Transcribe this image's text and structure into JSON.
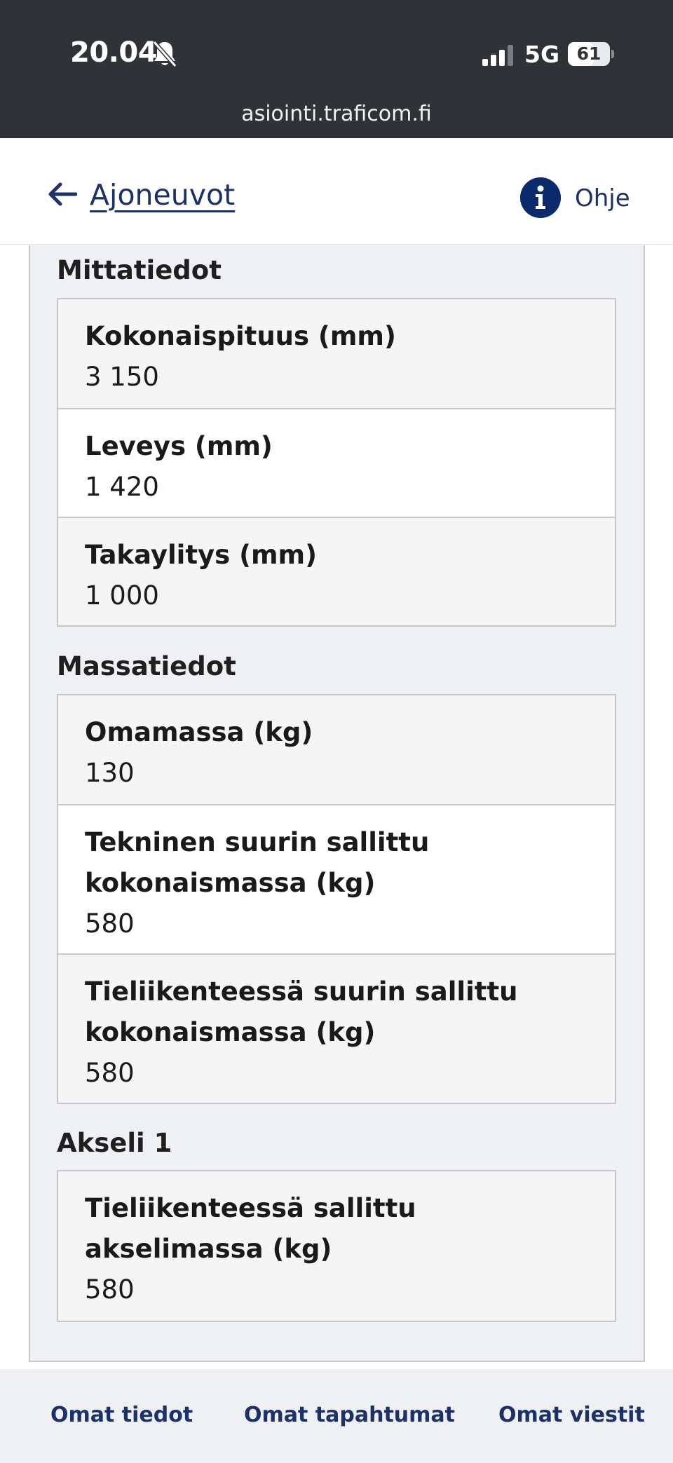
{
  "status_bar": {
    "time": "20.04",
    "network": "5G",
    "battery_level": "61",
    "battery_fraction": 0.61,
    "url": "asiointi.traficom.fi"
  },
  "header": {
    "back_label": "Ajoneuvot",
    "help_label": "Ohje"
  },
  "sections": {
    "mittatiedot": {
      "heading": "Mittatiedot",
      "rows": [
        {
          "label": "Kokonaispituus (mm)",
          "value": "3 150"
        },
        {
          "label": "Leveys (mm)",
          "value": "1 420"
        },
        {
          "label": "Takaylitys (mm)",
          "value": "1 000"
        }
      ]
    },
    "massatiedot": {
      "heading": "Massatiedot",
      "rows": [
        {
          "label": "Omamassa (kg)",
          "value": "130"
        },
        {
          "label": "Tekninen suurin sallittu kokonaismassa (kg)",
          "value": "580"
        },
        {
          "label": "Tieliikenteessä suurin sallittu kokonaismassa (kg)",
          "value": "580"
        }
      ]
    },
    "akseli1": {
      "heading": "Akseli 1",
      "rows": [
        {
          "label": "Tieliikenteessä sallittu akselimassa (kg)",
          "value": "580"
        }
      ]
    }
  },
  "bottom_nav": {
    "items": [
      {
        "label": "Omat tiedot"
      },
      {
        "label": "Omat tapahtumat"
      },
      {
        "label": "Omat viestit"
      }
    ]
  },
  "colors": {
    "brand_navy": "#1b3168",
    "status_bar_bg": "#2f3236",
    "panel_bg": "#eef0f3",
    "border": "#c6c8cc"
  },
  "icons": {
    "bell": "bell-slash-icon",
    "signal": "cellular-signal-icon",
    "battery": "battery-icon",
    "back": "arrow-left-icon",
    "help": "info-circle-icon"
  }
}
